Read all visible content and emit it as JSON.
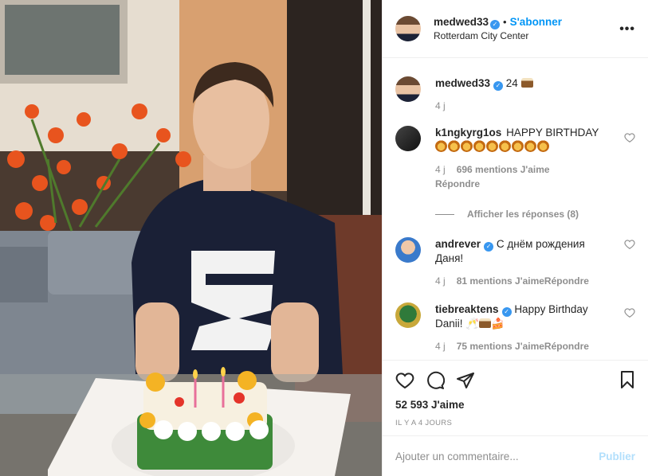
{
  "header": {
    "username": "medwed33",
    "separator": "•",
    "follow_label": "S'abonner",
    "location": "Rotterdam City Center",
    "more_icon": "more-horizontal-icon"
  },
  "caption": {
    "username": "medwed33",
    "text": "24",
    "emoji": "cake",
    "age": "4 j"
  },
  "comments": [
    {
      "username": "k1ngkyrg1os",
      "text": "HAPPY BIRTHDAY",
      "emoji_count": 9,
      "emoji": "lion-face",
      "age": "4 j",
      "likes": "696 mentions J'aime",
      "reply": "Répondre",
      "view_replies": "Afficher les réponses (8)"
    },
    {
      "username": "andrever",
      "text": "С днём рождения Даня!",
      "age": "4 j",
      "likes": "81 mentions J'aime",
      "reply": "Répondre"
    },
    {
      "username": "tiebreaktens",
      "text": "Happy Birthday Danii!",
      "emoji": "celebration, cake, cake-slice",
      "age": "4 j",
      "likes": "75 mentions J'aime",
      "reply": "Répondre"
    }
  ],
  "actions": {
    "likes": "52 593 J'aime",
    "time": "IL Y A 4 JOURS"
  },
  "add_comment": {
    "placeholder": "Ajouter un commentaire...",
    "publish_label": "Publier"
  },
  "colors": {
    "link_blue": "#0095f6",
    "verified_blue": "#3897f0",
    "publish_disabled": "#b2dffc",
    "muted": "#8e8e8e"
  }
}
